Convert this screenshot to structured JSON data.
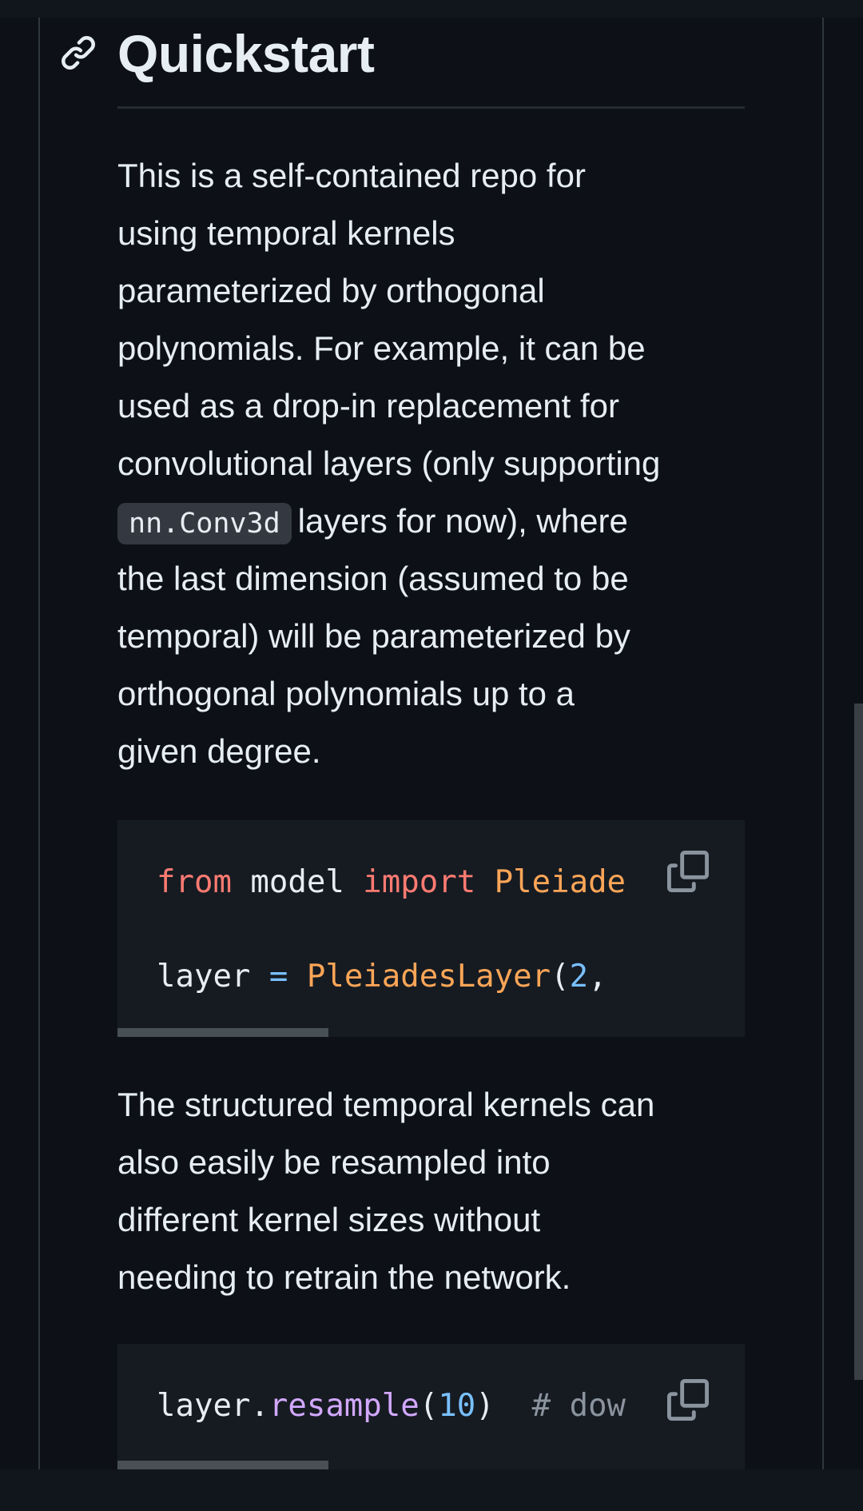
{
  "heading": {
    "title": "Quickstart",
    "icon": "link-icon"
  },
  "paragraph1": {
    "lines": [
      "This is a self-contained repo for",
      "using temporal kernels",
      "parameterized by orthogonal",
      "polynomials. For example, it can be",
      "used as a drop-in replacement for",
      "convolutional layers (only supporting"
    ],
    "inline_code": "nn.Conv3d",
    "line7_rest": "layers for now), where",
    "lines_after": [
      "the last dimension (assumed to be",
      "temporal) will be parameterized by",
      "orthogonal polynomials up to a",
      "given degree."
    ]
  },
  "code1": {
    "line1": {
      "kw1": "from",
      "mod": " model ",
      "kw2": "import",
      "cls": " Pleiade"
    },
    "line2": {
      "var": "layer ",
      "op": "=",
      "cls": " PleiadesLayer",
      "paren": "(",
      "num": "2",
      "comma": ","
    },
    "copy_icon": "copy-icon"
  },
  "paragraph2": {
    "lines": [
      "The structured temporal kernels can",
      "also easily be resampled into",
      "different kernel sizes without",
      "needing to retrain the network."
    ]
  },
  "code2": {
    "line1": {
      "obj": "layer.",
      "fn": "resample",
      "open": "(",
      "num": "10",
      "close": ")",
      "comment": "  # dow"
    },
    "copy_icon": "copy-icon"
  },
  "colors": {
    "background": "#0d1117",
    "code_bg": "#161b22",
    "keyword": "#ff7b72",
    "class": "#ffa657",
    "number": "#79c0ff",
    "function": "#d2a8ff",
    "comment": "#8b949e"
  }
}
